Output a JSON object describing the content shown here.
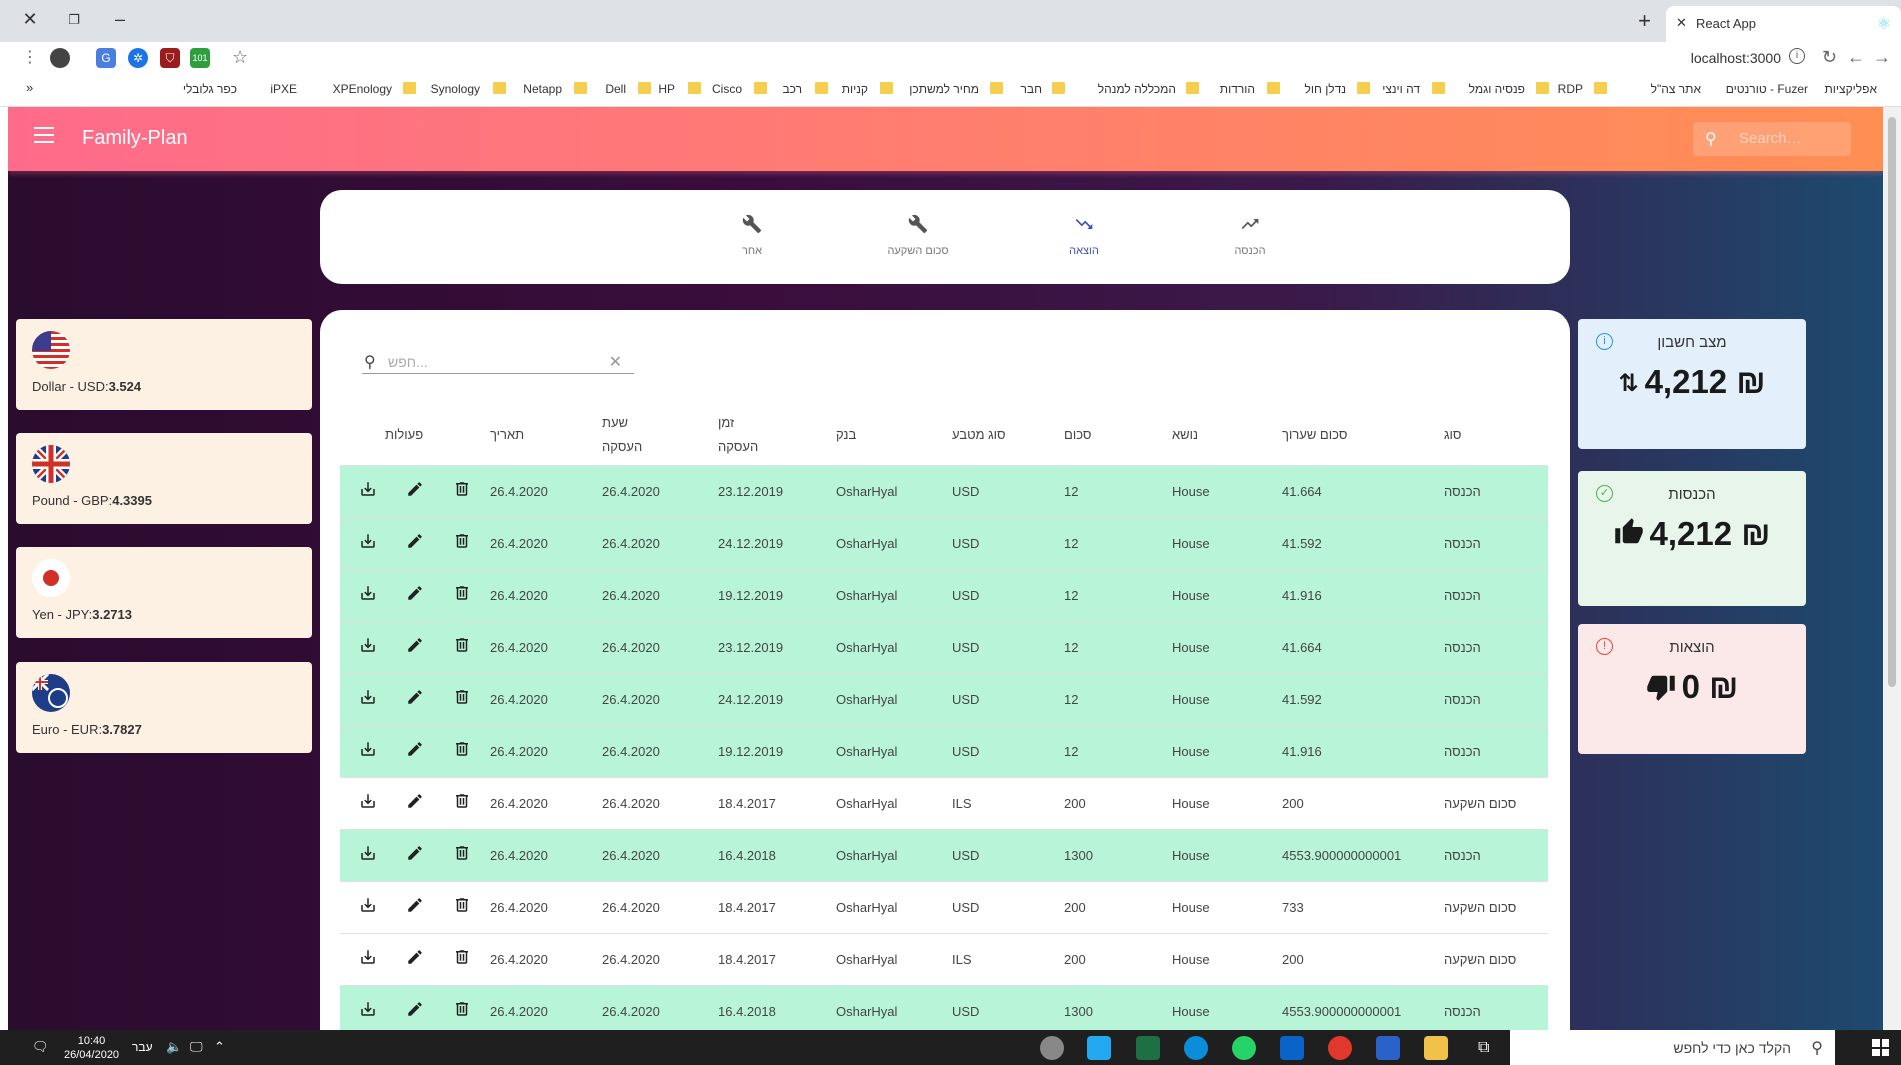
{
  "browser": {
    "tab_title": "React App",
    "url": "localhost:3000",
    "bookmarks": [
      "אפליקציות",
      "טורנטים - Fuzer",
      "אתר צה\"ל",
      "RDP",
      "פנסיה וגמל",
      "דה וינצי",
      "נדלן חול",
      "הורדות",
      "המכללה למנהל",
      "חבר",
      "מחיר למשתכן",
      "קניות",
      "רכב",
      "Cisco",
      "HP",
      "Dell",
      "Netapp",
      "Synology",
      "XPEnology",
      "iPXE",
      "כפר גלובלי"
    ],
    "extension_badge": "101"
  },
  "appbar": {
    "title": "Family-Plan",
    "search_placeholder": "Search…"
  },
  "tabs": [
    {
      "label": "הכנסה",
      "icon": "trending-up-icon"
    },
    {
      "label": "הוצאה",
      "icon": "trending-down-icon"
    },
    {
      "label": "סכום השקעה",
      "icon": "wrench-icon"
    },
    {
      "label": "אחר",
      "icon": "wrench-icon"
    }
  ],
  "currencies": [
    {
      "name": "Dollar - USD:",
      "rate": "3.524"
    },
    {
      "name": "Pound - GBP:",
      "rate": "4.3395"
    },
    {
      "name": "Yen - JPY:",
      "rate": "3.2713"
    },
    {
      "name": "Euro - EUR:",
      "rate": "3.7827"
    }
  ],
  "table": {
    "search_placeholder": "חפש...",
    "headers": {
      "actions": "פעולות",
      "date": "תאריך",
      "trans_time_1": "שעת",
      "trans_time_2": "העסקה",
      "trans_date_1": "זמן",
      "trans_date_2": "העסקה",
      "bank": "בנק",
      "currency": "סוג מטבע",
      "amount": "סכום",
      "subject": "נושא",
      "value": "סכום שערוך",
      "type": "סוג"
    },
    "rows": [
      {
        "kind": "income",
        "date": "26.4.2020",
        "trans_time": "26.4.2020",
        "trans_date": "23.12.2019",
        "bank": "OsharHyal",
        "currency": "USD",
        "amount": "12",
        "subject": "House",
        "value": "41.664",
        "type": "הכנסה"
      },
      {
        "kind": "income",
        "date": "26.4.2020",
        "trans_time": "26.4.2020",
        "trans_date": "24.12.2019",
        "bank": "OsharHyal",
        "currency": "USD",
        "amount": "12",
        "subject": "House",
        "value": "41.592",
        "type": "הכנסה"
      },
      {
        "kind": "income",
        "date": "26.4.2020",
        "trans_time": "26.4.2020",
        "trans_date": "19.12.2019",
        "bank": "OsharHyal",
        "currency": "USD",
        "amount": "12",
        "subject": "House",
        "value": "41.916",
        "type": "הכנסה"
      },
      {
        "kind": "income",
        "date": "26.4.2020",
        "trans_time": "26.4.2020",
        "trans_date": "23.12.2019",
        "bank": "OsharHyal",
        "currency": "USD",
        "amount": "12",
        "subject": "House",
        "value": "41.664",
        "type": "הכנסה"
      },
      {
        "kind": "income",
        "date": "26.4.2020",
        "trans_time": "26.4.2020",
        "trans_date": "24.12.2019",
        "bank": "OsharHyal",
        "currency": "USD",
        "amount": "12",
        "subject": "House",
        "value": "41.592",
        "type": "הכנסה"
      },
      {
        "kind": "income",
        "date": "26.4.2020",
        "trans_time": "26.4.2020",
        "trans_date": "19.12.2019",
        "bank": "OsharHyal",
        "currency": "USD",
        "amount": "12",
        "subject": "House",
        "value": "41.916",
        "type": "הכנסה"
      },
      {
        "kind": "invest",
        "date": "26.4.2020",
        "trans_time": "26.4.2020",
        "trans_date": "18.4.2017",
        "bank": "OsharHyal",
        "currency": "ILS",
        "amount": "200",
        "subject": "House",
        "value": "200",
        "type": "סכום השקעה"
      },
      {
        "kind": "income",
        "date": "26.4.2020",
        "trans_time": "26.4.2020",
        "trans_date": "16.4.2018",
        "bank": "OsharHyal",
        "currency": "USD",
        "amount": "1300",
        "subject": "House",
        "value": "4553.900000000001",
        "type": "הכנסה"
      },
      {
        "kind": "invest",
        "date": "26.4.2020",
        "trans_time": "26.4.2020",
        "trans_date": "18.4.2017",
        "bank": "OsharHyal",
        "currency": "USD",
        "amount": "200",
        "subject": "House",
        "value": "733",
        "type": "סכום השקעה"
      },
      {
        "kind": "invest",
        "date": "26.4.2020",
        "trans_time": "26.4.2020",
        "trans_date": "18.4.2017",
        "bank": "OsharHyal",
        "currency": "ILS",
        "amount": "200",
        "subject": "House",
        "value": "200",
        "type": "סכום השקעה"
      },
      {
        "kind": "income",
        "date": "26.4.2020",
        "trans_time": "26.4.2020",
        "trans_date": "16.4.2018",
        "bank": "OsharHyal",
        "currency": "USD",
        "amount": "1300",
        "subject": "House",
        "value": "4553.900000000001",
        "type": "הכנסה"
      }
    ]
  },
  "stats": {
    "balance": {
      "title": "מצב חשבון",
      "value": "4,212",
      "currency": "₪",
      "color": "#e3f0fb"
    },
    "income": {
      "title": "הכנסות",
      "value": "4,212",
      "currency": "₪",
      "color": "#e8f5ea"
    },
    "expense": {
      "title": "הוצאות",
      "value": "0",
      "currency": "₪",
      "color": "#fbe9e9"
    }
  },
  "taskbar": {
    "time": "10:40",
    "date": "26/04/2020",
    "lang": "עבר",
    "search_placeholder": "הקלד כאן כדי לחפש"
  }
}
